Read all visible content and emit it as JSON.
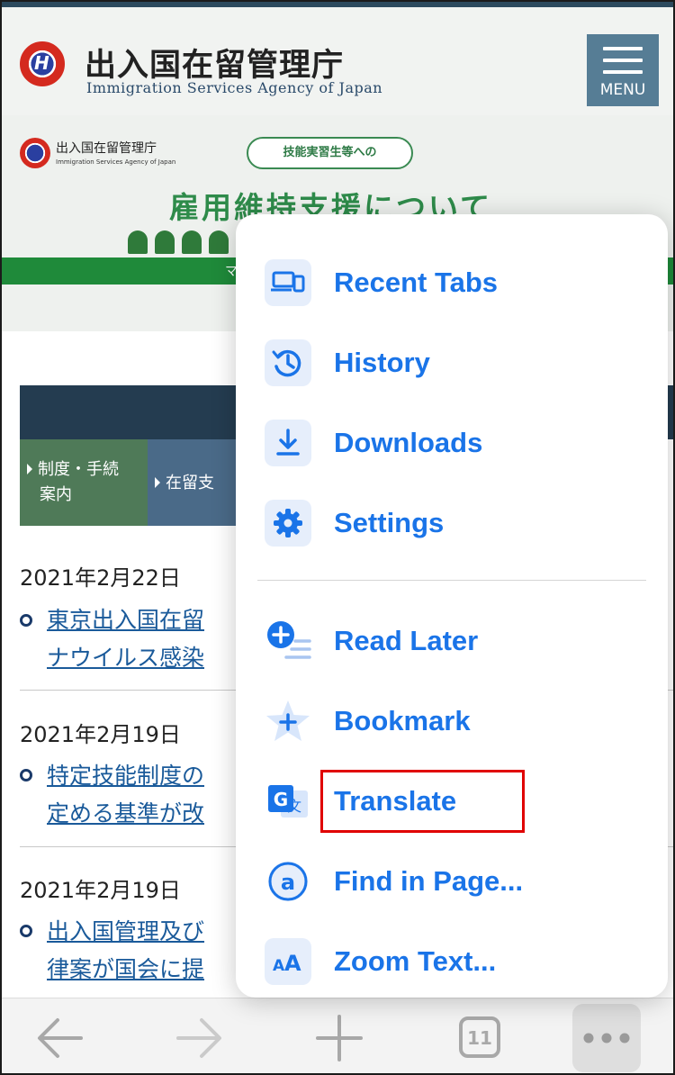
{
  "header": {
    "agency_name_jp": "出入国在留管理庁",
    "agency_name_en": "Immigration Services Agency of Japan",
    "menu_label": "MENU",
    "emblem_letter": "H"
  },
  "banner": {
    "mini_jp": "出入国在留管理庁",
    "mini_en": "Immigration Services Agency of Japan",
    "pill_text": "技能実習生等への",
    "title": "雇用維持支援について",
    "greenbar_text": "マ"
  },
  "nav": {
    "tile1": [
      "制度・手続",
      "案内"
    ],
    "tile2": "在留支"
  },
  "news": [
    {
      "date": "2021年2月22日",
      "lines": [
        "東京出入国在留",
        "ナウイルス感染"
      ]
    },
    {
      "date": "2021年2月19日",
      "lines": [
        "特定技能制度の",
        "定める基準が改"
      ]
    },
    {
      "date": "2021年2月19日",
      "lines": [
        "出入国管理及び",
        "律案が国会に提"
      ]
    }
  ],
  "menu": {
    "items": [
      {
        "label": "Recent Tabs",
        "icon": "recent-tabs-icon"
      },
      {
        "label": "History",
        "icon": "history-icon"
      },
      {
        "label": "Downloads",
        "icon": "download-icon"
      },
      {
        "label": "Settings",
        "icon": "gear-icon"
      },
      {
        "label": "Read Later",
        "icon": "read-later-icon"
      },
      {
        "label": "Bookmark",
        "icon": "star-plus-icon"
      },
      {
        "label": "Translate",
        "icon": "translate-icon"
      },
      {
        "label": "Find in Page...",
        "icon": "find-icon"
      },
      {
        "label": "Zoom Text...",
        "icon": "zoom-text-icon"
      }
    ]
  },
  "toolbar": {
    "tab_count": "11"
  },
  "colors": {
    "accent": "#1a74e8",
    "highlight": "#e00000"
  }
}
